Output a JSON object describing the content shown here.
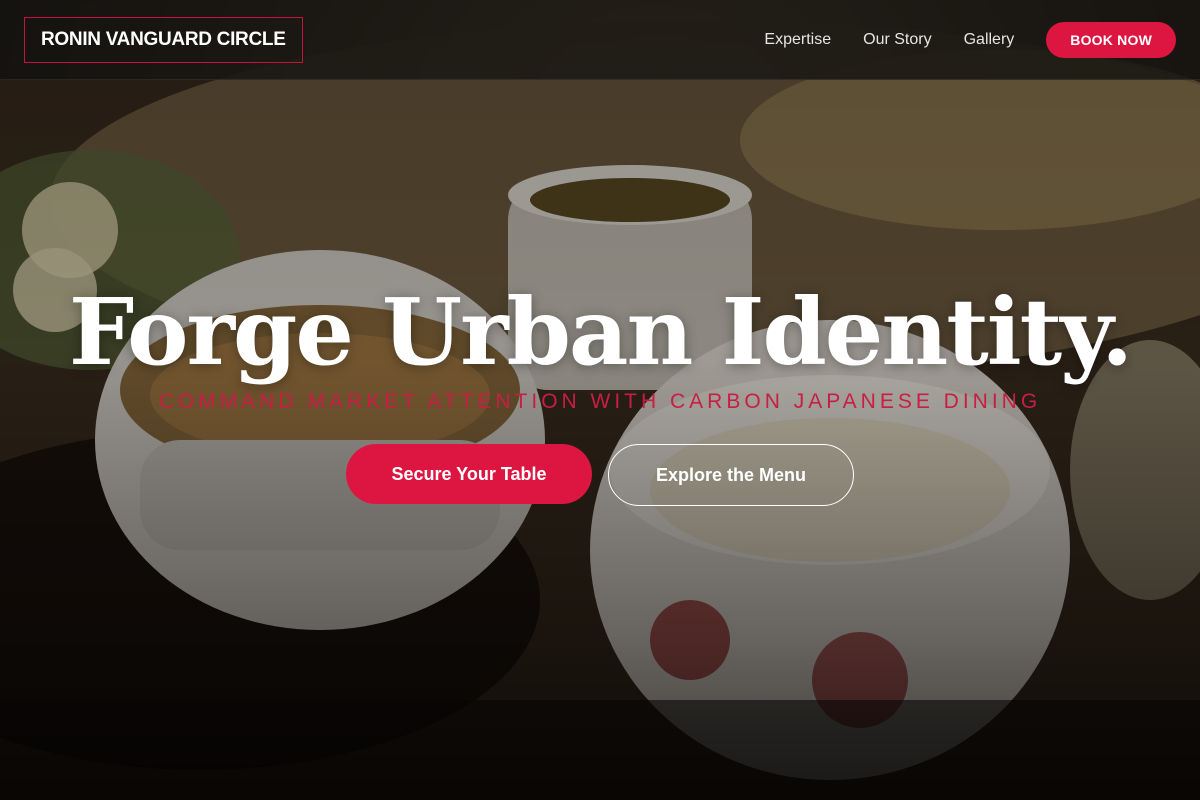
{
  "header": {
    "brand": "RONIN VANGUARD CIRCLE",
    "nav": [
      {
        "label": "Expertise"
      },
      {
        "label": "Our Story"
      },
      {
        "label": "Gallery"
      }
    ],
    "cta_label": "BOOK NOW"
  },
  "hero": {
    "headline": "Forge Urban Identity.",
    "subheadline": "COMMAND MARKET ATTENTION WITH CARBON JAPANESE DINING",
    "primary_cta": "Secure Your Table",
    "secondary_cta": "Explore the Menu",
    "background_image": "japanese-meal-photo"
  },
  "colors": {
    "accent": "#dc1640",
    "header_bg": "#141210",
    "text": "#ffffff"
  }
}
